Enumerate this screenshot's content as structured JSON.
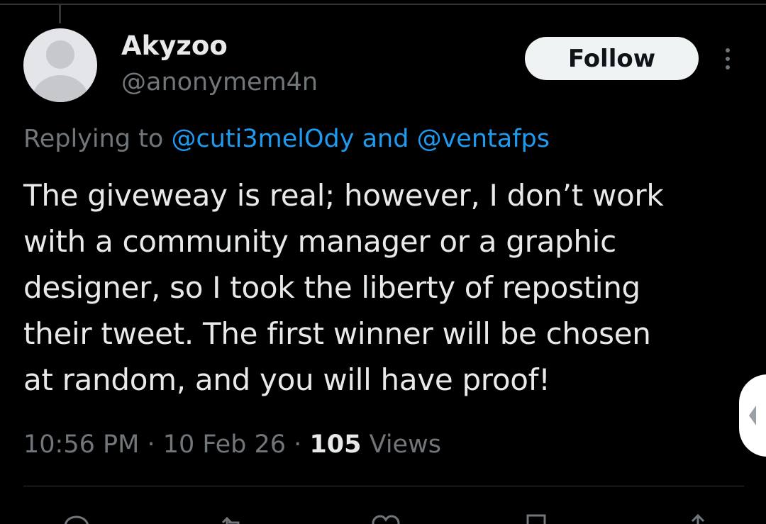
{
  "tweet": {
    "author": {
      "display_name": "Akyzoo",
      "handle": "@anonymem4n"
    },
    "follow_label": "Follow",
    "replying": {
      "prefix": "Replying to",
      "mention_1": "@cuti3melOdy",
      "conjunction": "and",
      "mention_2": "@ventafps"
    },
    "text": "The giveweay is real; however, I don’t work\nwith a community manager or a graphic\ndesigner, so I took the liberty of reposting\ntheir tweet. The first winner will be chosen\nat random, and you will have proof!",
    "time": "10:56 PM",
    "separator": "·",
    "date": "10 Feb 26",
    "views_count": "105",
    "views_label": "Views"
  },
  "actions": [
    {
      "icon": "reply-icon"
    },
    {
      "icon": "repost-icon"
    },
    {
      "icon": "like-icon"
    },
    {
      "icon": "bookmark-icon"
    },
    {
      "icon": "share-icon"
    }
  ],
  "colors": {
    "background": "#000000",
    "text_primary": "#e7e9ea",
    "text_secondary": "#71767b",
    "link": "#1d9bf0",
    "follow_button_bg": "#eff3f4"
  }
}
